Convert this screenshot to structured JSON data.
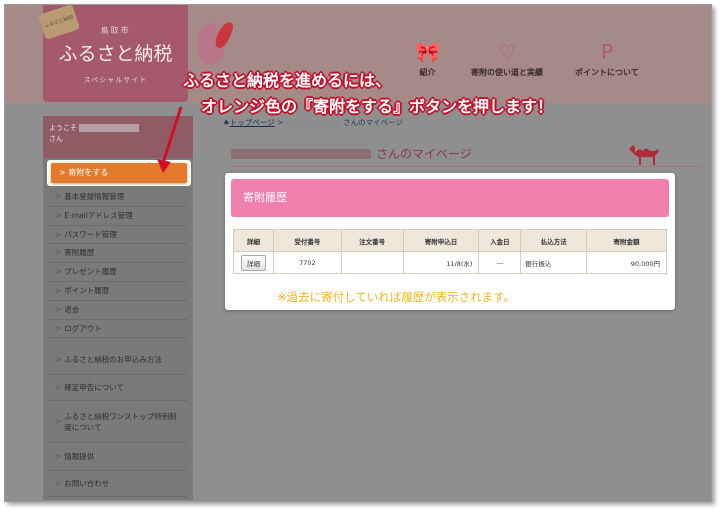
{
  "header": {
    "logo_tag": "ふるさと納税",
    "city": "鳥取市",
    "title": "ふるさと納税",
    "subtitle": "スペシャルサイト",
    "nav": [
      {
        "label": "紹介",
        "icon": "gift-icon"
      },
      {
        "label": "寄附の使い道と実績",
        "icon": "heart-icon"
      },
      {
        "label": "ポイントについて",
        "icon": "p-point-icon"
      }
    ]
  },
  "sidebar": {
    "welcome_line1": "ようこそ",
    "welcome_line2": "さん",
    "donate_button": "寄附をする",
    "menu": [
      "基本登録情報管理",
      "E-mailアドレス管理",
      "パスワード管理",
      "寄附履歴",
      "プレゼント履歴",
      "ポイント履歴",
      "退会",
      "ログアウト"
    ],
    "menu2": [
      "ふるさと納税のお申込み方法",
      "確定申告について",
      "ふるさと納税ワンストップ特例制度について",
      "情報提供",
      "お問い合わせ"
    ]
  },
  "breadcrumb": {
    "home": "トップページ",
    "sep": ">",
    "current": "さんのマイページ"
  },
  "page_title": "さんのマイページ",
  "history": {
    "heading": "寄附履歴",
    "columns": [
      "詳細",
      "受付番号",
      "注文番号",
      "寄附申込日",
      "入金日",
      "払込方法",
      "寄附金額"
    ],
    "rows": [
      {
        "detail": "詳細",
        "receipt_no": "7702",
        "order_no": "",
        "date": "11/8(水)",
        "paid_date": "---",
        "method": "銀行振込",
        "amount": "90,000円"
      }
    ]
  },
  "note": "※過去に寄付していれば履歴が表示されます。",
  "callout": {
    "line1": "ふるさと納税を進めるには、",
    "line2": "オレンジ色の『寄附をする』ボタンを押します！"
  },
  "colors": {
    "orange_button": "#e3792b",
    "pink_header": "#f07fa9",
    "callout_outline": "#c5102a",
    "note": "#f2b51f"
  }
}
